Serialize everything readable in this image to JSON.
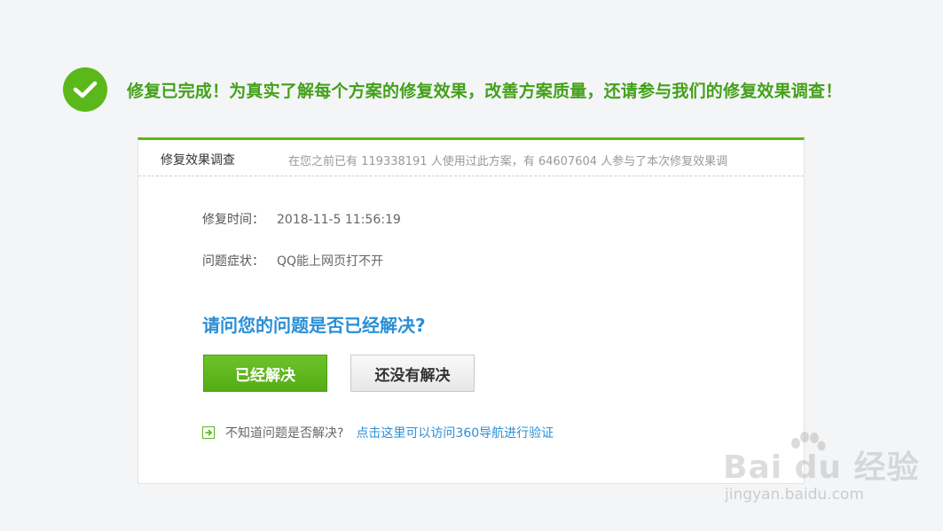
{
  "banner": {
    "message": "修复已完成！为真实了解每个方案的修复效果，改善方案质量，还请参与我们的修复效果调查！"
  },
  "survey": {
    "title": "修复效果调查",
    "stats": "在您之前已有 119338191 人使用过此方案，有 64607604 人参与了本次修复效果调",
    "fix_time_label": "修复时间：",
    "fix_time_value": "2018-11-5 11:56:19",
    "symptom_label": "问题症状：",
    "symptom_value": "QQ能上网页打不开",
    "question": "请问您的问题是否已经解决?",
    "resolved_label": "已经解决",
    "unresolved_label": "还没有解决",
    "help_text": "不知道问题是否解决?",
    "help_link": "点击这里可以访问360导航进行验证"
  },
  "watermark": {
    "brand": "Bai du 经验",
    "url": "jingyan.baidu.com"
  },
  "colors": {
    "accent_green": "#5bb81a",
    "link_blue": "#2a8fd6"
  },
  "icons": {
    "banner": "check-circle-icon",
    "help": "arrow-right-box-icon",
    "watermark": "paw-icon"
  }
}
